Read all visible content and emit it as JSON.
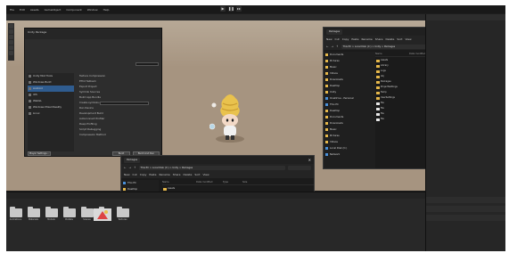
{
  "topbar": {
    "items": [
      "File",
      "Edit",
      "Assets",
      "GameObject",
      "Component",
      "Window",
      "Help"
    ]
  },
  "scene": {
    "toolbar_label": ""
  },
  "dialog_left": {
    "title": "Unity Package",
    "subtitle": "",
    "sidebar": [
      "Unity Mod Tools",
      "Windows Build",
      "Android",
      "iOS",
      "WebGL",
      "Windows Mixed Reality",
      "Linux"
    ],
    "selected_index": 2,
    "labels": [
      "Texture Compression",
      "ETC2 fallback",
      "Export Project",
      "Symlink Sources",
      "Build App Bundle",
      "Create symbols.zip",
      "Run Device",
      "Development Build",
      "Autoconnect Profiler",
      "Deep Profiling",
      "Script Debugging",
      "Compression Method"
    ],
    "buttons": [
      "Player Settings...",
      "Build",
      "Build And Run"
    ]
  },
  "explorer_top": {
    "tab": "Packages",
    "address": "This PC > Local Disk (C:) > Unity > Packages",
    "toolbar": [
      "New",
      "Cut",
      "Copy",
      "Paste",
      "Rename",
      "Share",
      "Delete",
      "Sort",
      "View"
    ],
    "nav": [
      {
        "label": "Documents",
        "type": "folder"
      },
      {
        "label": "Pictures",
        "type": "folder"
      },
      {
        "label": "Music",
        "type": "folder"
      },
      {
        "label": "Videos",
        "type": "folder"
      },
      {
        "label": "Downloads",
        "type": "folder"
      },
      {
        "label": "Desktop",
        "type": "folder"
      },
      {
        "label": "Unity",
        "type": "folder"
      },
      {
        "label": "OneDrive - Personal",
        "type": "cloud"
      },
      {
        "label": "This PC",
        "type": "pc"
      },
      {
        "label": "Desktop",
        "type": "folder"
      },
      {
        "label": "Documents",
        "type": "folder"
      },
      {
        "label": "Downloads",
        "type": "folder"
      },
      {
        "label": "Music",
        "type": "folder"
      },
      {
        "label": "Pictures",
        "type": "folder"
      },
      {
        "label": "Videos",
        "type": "folder"
      },
      {
        "label": "Local Disk (C:)",
        "type": "drive"
      },
      {
        "label": "Network",
        "type": "net"
      }
    ],
    "columns": [
      "Name",
      "Date modified",
      "Type",
      "Size"
    ],
    "rows": [
      {
        "name": "Assets",
        "date": "",
        "type": "File folder",
        "size": "",
        "kind": "folder"
      },
      {
        "name": "Library",
        "date": "",
        "type": "File folder",
        "size": "",
        "kind": "folder"
      },
      {
        "name": "Logs",
        "date": "",
        "type": "File folder",
        "size": "",
        "kind": "folder"
      },
      {
        "name": "obj",
        "date": "",
        "type": "File folder",
        "size": "",
        "kind": "folder"
      },
      {
        "name": "Packages",
        "date": "",
        "type": "File folder",
        "size": "",
        "kind": "folder"
      },
      {
        "name": "ProjectSettings",
        "date": "",
        "type": "File folder",
        "size": "",
        "kind": "folder"
      },
      {
        "name": "Temp",
        "date": "",
        "type": "File folder",
        "size": "",
        "kind": "folder"
      },
      {
        "name": "UserSettings",
        "date": "",
        "type": "File folder",
        "size": "",
        "kind": "folder"
      },
      {
        "name": "file",
        "date": "",
        "type": "",
        "size": "",
        "kind": "doc"
      },
      {
        "name": "file",
        "date": "",
        "type": "",
        "size": "",
        "kind": "doc"
      },
      {
        "name": "file",
        "date": "",
        "type": "",
        "size": "",
        "kind": "doc"
      },
      {
        "name": "file",
        "date": "",
        "type": "",
        "size": "",
        "kind": "doc"
      }
    ]
  },
  "explorer_bottom": {
    "tab": "Packages",
    "address": "This PC > Local Disk (C:) > Unity > Packages",
    "toolbar": [
      "New",
      "Cut",
      "Copy",
      "Paste",
      "Rename",
      "Share",
      "Delete",
      "Sort",
      "View"
    ],
    "nav": [
      {
        "label": "This PC",
        "type": "pc"
      },
      {
        "label": "Desktop",
        "type": "folder"
      },
      {
        "label": "Documents",
        "type": "folder"
      },
      {
        "label": "Downloads",
        "type": "folder"
      },
      {
        "label": "Music",
        "type": "folder"
      },
      {
        "label": "Pictures",
        "type": "folder"
      },
      {
        "label": "Videos",
        "type": "folder"
      },
      {
        "label": "Local Disk (C:)",
        "type": "drive"
      },
      {
        "label": "Network",
        "type": "net"
      }
    ],
    "columns": [
      "Name",
      "Date modified",
      "Type",
      "Size"
    ],
    "rows": [
      {
        "name": "Assets",
        "kind": "folder"
      },
      {
        "name": "Library",
        "kind": "folder"
      },
      {
        "name": "Logs",
        "kind": "folder"
      },
      {
        "name": "obj",
        "kind": "folder"
      },
      {
        "name": "Packages",
        "kind": "folder"
      },
      {
        "name": "ProjectSettings",
        "kind": "folder"
      },
      {
        "name": "Temp",
        "kind": "folder"
      },
      {
        "name": "UserSettings",
        "kind": "folder"
      },
      {
        "name": "file",
        "kind": "doc"
      },
      {
        "name": "file",
        "kind": "doc"
      },
      {
        "name": "file",
        "kind": "doc"
      },
      {
        "name": "file",
        "kind": "doc"
      }
    ],
    "filename_label": "File name:",
    "filetype_label": "Save as type:",
    "filename_value": "",
    "buttons": [
      "Save",
      "Cancel"
    ]
  },
  "project": {
    "assets": [
      "Animations",
      "Materials",
      "Models",
      "Prefabs",
      "Scenes",
      "Scripts",
      "Textures"
    ]
  }
}
